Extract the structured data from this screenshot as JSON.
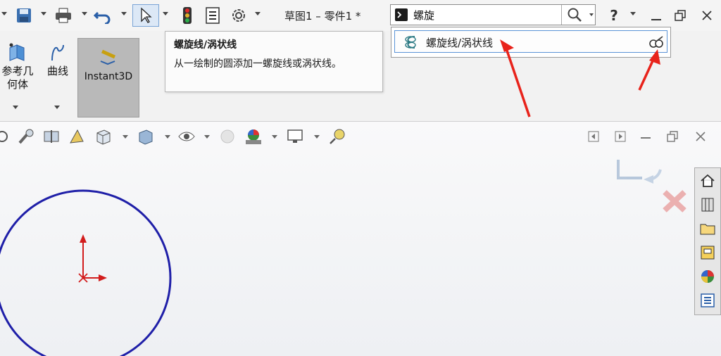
{
  "title_bar": {
    "document_title": "草图1 – 零件1 *"
  },
  "search": {
    "value": "螺旋",
    "placeholder": ""
  },
  "ribbon": {
    "ref_geometry_label": "参考几\n何体",
    "curves_label": "曲线",
    "instant3d_label": "Instant3D"
  },
  "tooltip": {
    "title": "螺旋线/涡状线",
    "description": "从一绘制的圆添加一螺旋线或涡状线。"
  },
  "search_results": [
    {
      "label": "螺旋线/涡状线"
    }
  ],
  "colors": {
    "circle": "#1f1fa8",
    "axis": "#d21c1c",
    "annotation_arrow": "#e8231b",
    "highlight_border": "#5a93d6"
  }
}
